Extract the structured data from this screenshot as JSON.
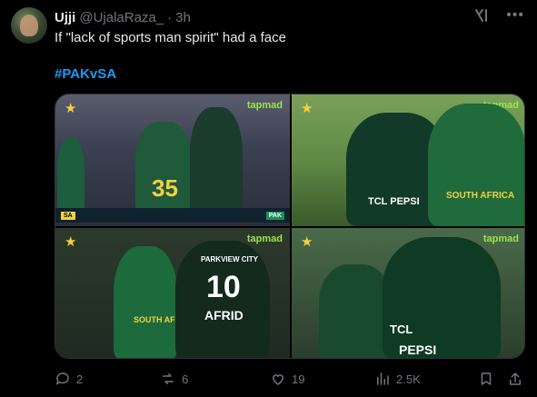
{
  "tweet": {
    "name": "Ujji",
    "handle": "@UjalaRaza_",
    "separator": "·",
    "time": "3h",
    "text": "If \"lack of sports man spirit\" had a face",
    "hashtag": "#PAKvSA"
  },
  "media": {
    "tiles": [
      {
        "logo": "tapmad",
        "jersey": "35",
        "score_left": "SA",
        "score_right": "PAK"
      },
      {
        "logo": "tapmad",
        "jersey_text": "SOUTH AFRICA",
        "sponsor": "TCL PEPSI"
      },
      {
        "logo": "tapmad",
        "jersey": "10",
        "name_text": "AFRID",
        "sponsor_text": "PARKVIEW CITY",
        "sa_text": "SOUTH AFRICA"
      },
      {
        "logo": "tapmad",
        "sponsor": "TCL",
        "sponsor2": "PEPSI"
      }
    ]
  },
  "actions": {
    "replies": "2",
    "reposts": "6",
    "likes": "19",
    "views": "2.5K"
  },
  "colors": {
    "accent": "#1d9bf0",
    "muted": "#71767b",
    "text": "#e7e9ea"
  }
}
